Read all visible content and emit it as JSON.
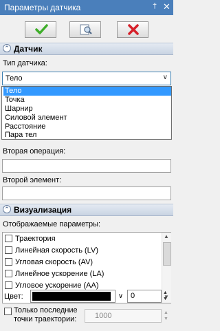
{
  "window": {
    "title": "Параметры датчика",
    "pin_icon": "pin-icon",
    "close_icon": "close-icon"
  },
  "toolbar": {
    "ok_icon": "checkmark-icon",
    "preview_icon": "preview-icon",
    "cancel_icon": "cancel-icon"
  },
  "sensor_section": {
    "label": "Датчик"
  },
  "sensor_type": {
    "label": "Тип датчика:",
    "value": "Тело",
    "options": [
      "Тело",
      "Точка",
      "Шарнир",
      "Силовой элемент",
      "Расстояние",
      "Пара тел"
    ]
  },
  "second_operation": {
    "label": "Вторая операция:",
    "value": ""
  },
  "second_element": {
    "label": "Второй элемент:",
    "value": ""
  },
  "visual_section": {
    "label": "Визуализация"
  },
  "displayed_params": {
    "label": "Отображаемые параметры:",
    "items": [
      "Траектория",
      "Линейная скорость (LV)",
      "Угловая скорость (AV)",
      "Линейное ускорение (LA)",
      "Угловое ускорение (AA)"
    ]
  },
  "color": {
    "label": "Цвет:",
    "value": "#000000",
    "width_value": "0"
  },
  "last_points": {
    "label_line1": "Только последние",
    "label_line2": "точки траектории:",
    "value": "1000"
  },
  "colors": {
    "title_bar": "#4a7fbb",
    "selection": "#3399ff",
    "ok_green": "#3fae2a",
    "cancel_red": "#d6202a"
  }
}
